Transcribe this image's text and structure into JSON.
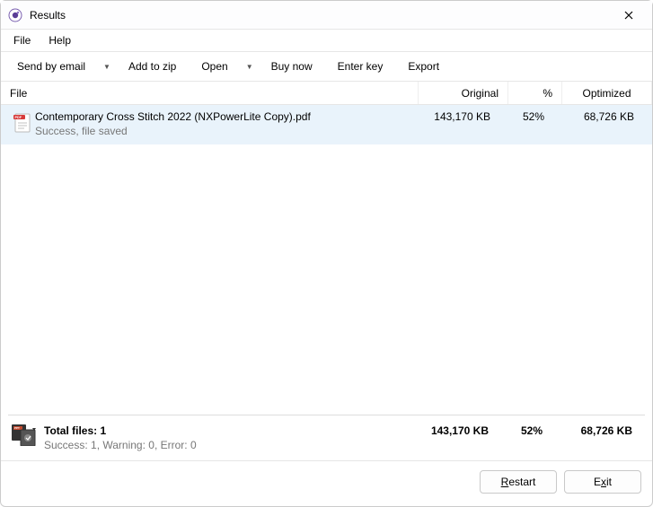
{
  "window": {
    "title": "Results"
  },
  "menubar": {
    "file": "File",
    "help": "Help"
  },
  "toolbar": {
    "send_by_email": "Send by email",
    "add_to_zip": "Add to zip",
    "open": "Open",
    "buy_now": "Buy now",
    "enter_key": "Enter key",
    "export": "Export"
  },
  "columns": {
    "file": "File",
    "original": "Original",
    "percent": "%",
    "optimized": "Optimized"
  },
  "rows": [
    {
      "name": "Contemporary Cross Stitch 2022 (NXPowerLite Copy).pdf",
      "status": "Success, file saved",
      "original": "143,170 KB",
      "percent": "52%",
      "optimized": "68,726 KB",
      "selected": true,
      "icon": "pdf"
    }
  ],
  "summary": {
    "title": "Total files: 1",
    "subtitle": "Success: 1, Warning: 0, Error: 0",
    "original": "143,170 KB",
    "percent": "52%",
    "optimized": "68,726 KB"
  },
  "footer": {
    "restart_pre": "",
    "restart_accel": "R",
    "restart_post": "estart",
    "exit_pre": "E",
    "exit_accel": "x",
    "exit_post": "it"
  }
}
